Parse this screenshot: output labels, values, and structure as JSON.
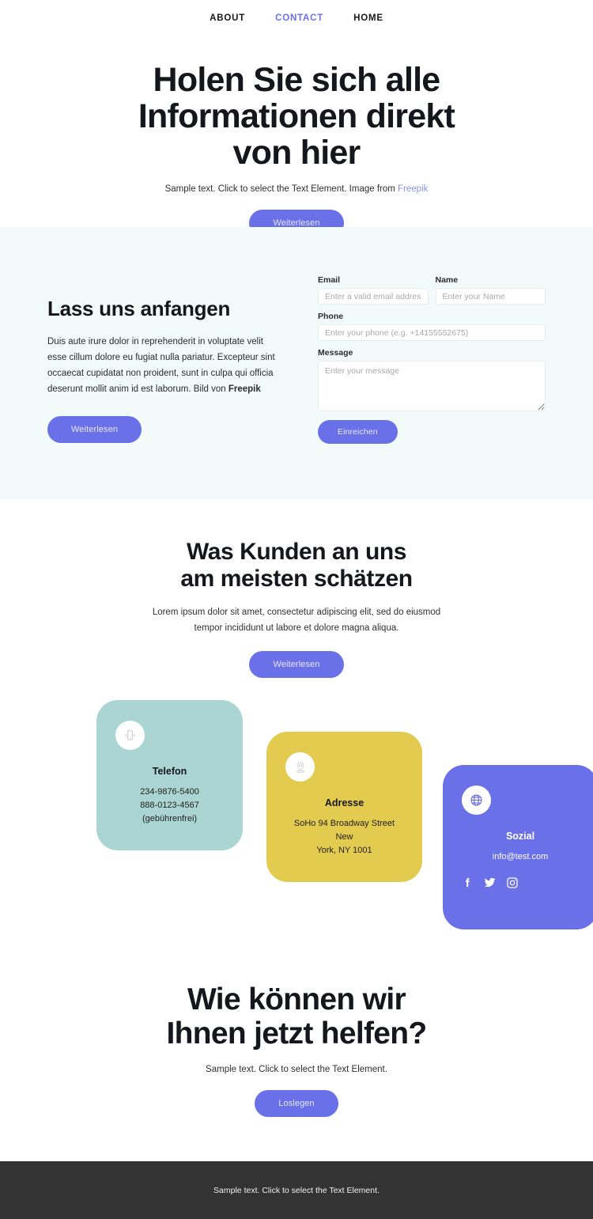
{
  "nav": {
    "items": [
      {
        "label": "ABOUT",
        "active": false
      },
      {
        "label": "CONTACT",
        "active": true
      },
      {
        "label": "HOME",
        "active": false
      }
    ]
  },
  "hero": {
    "heading_line1_pre": "Holen ",
    "heading_line1_hl": "Sie sich alle",
    "heading_line2": "Informationen direkt",
    "heading_line3": "von hier",
    "subtitle_pre": "Sample text. Click to select the Text Element. Image from ",
    "subtitle_link": "Freepik",
    "button_label": "Weiterlesen",
    "highlight_color": "#abd5d2"
  },
  "form_section": {
    "heading": "Lass uns anfangen",
    "body_pre": "Duis aute irure dolor in reprehenderit in voluptate velit esse cillum dolore eu fugiat nulla pariatur. Excepteur sint occaecat cupidatat non proident, sunt in culpa qui officia deserunt mollit anim id est laborum. Bild von ",
    "body_bold": "Freepik",
    "button_label": "Weiterlesen",
    "background_color": "#f2fafa",
    "fields": {
      "email": {
        "label": "Email",
        "placeholder": "Enter a valid email address",
        "value": ""
      },
      "name": {
        "label": "Name",
        "placeholder": "Enter your Name",
        "value": ""
      },
      "phone": {
        "label": "Phone",
        "placeholder": "Enter your phone (e.g. +14155552675)",
        "value": ""
      },
      "message": {
        "label": "Message",
        "placeholder": "Enter your message",
        "value": ""
      }
    },
    "submit_label": "Einreichen"
  },
  "testimonials": {
    "heading_line1_pre": "Was ",
    "heading_line1_hl": "Kunden an",
    "heading_line1_post": " uns",
    "heading_line2": "am meisten schätzen",
    "subtitle": "Lorem ipsum dolor sit amet, consectetur adipiscing elit, sed do eiusmod tempor incididunt ut labore et dolore magna aliqua.",
    "button_label": "Weiterlesen",
    "highlight_color": "#e3cb4f"
  },
  "cards": [
    {
      "icon": "mobile-phone-icon",
      "title": "Telefon",
      "line1": "234-9876-5400",
      "line2": "888-0123-4567 (gebührenfrei)",
      "color": "#abd5d2"
    },
    {
      "icon": "map-pin-icon",
      "title": "Adresse",
      "line1": "SoHo 94 Broadway Street New",
      "line2": "York, NY 1001",
      "color": "#e3cb4f"
    },
    {
      "icon": "globe-icon",
      "title": "Sozial",
      "line1": "info@test.com",
      "line2": "",
      "color": "#6a70e8",
      "socials": [
        "facebook-icon",
        "twitter-icon",
        "instagram-icon"
      ]
    }
  ],
  "cta": {
    "heading_line1_pre": "Wie ",
    "heading_line1_hl": "können",
    "heading_line1_post": " wir",
    "heading_line2": "Ihnen jetzt helfen?",
    "subtitle": "Sample text. Click to select the Text Element.",
    "button_label": "Loslegen",
    "highlight_color": "#abd5d2"
  },
  "footer": {
    "text": "Sample text. Click to select the Text Element.",
    "background_color": "#333333"
  },
  "theme": {
    "accent": "#6a70e8",
    "mint": "#abd5d2",
    "yellow": "#e3cb4f",
    "pale_mint": "#f2fafa",
    "dark": "#333333"
  }
}
